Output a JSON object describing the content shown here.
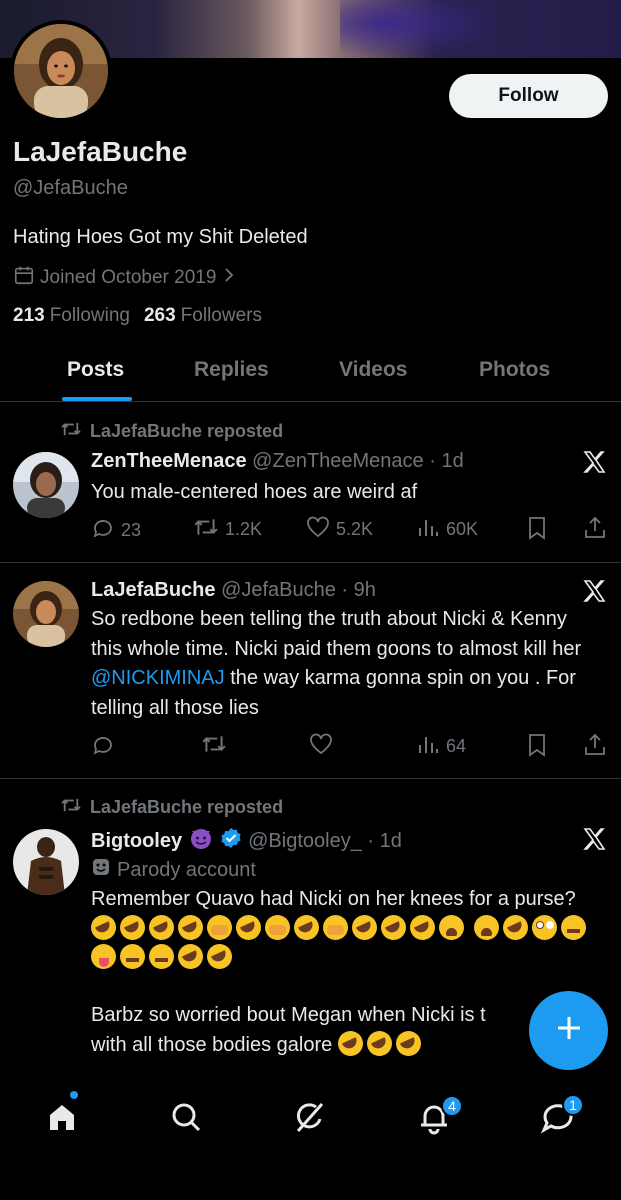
{
  "profile": {
    "display_name": "LaJefaBuche",
    "handle": "@JefaBuche",
    "bio": "Hating Hoes Got my Shit Deleted",
    "joined": "Joined October 2019",
    "following_count": "213",
    "following_label": "Following",
    "followers_count": "263",
    "followers_label": "Followers",
    "follow_label": "Follow"
  },
  "tabs": [
    {
      "label": "Posts",
      "active": true
    },
    {
      "label": "Replies",
      "active": false
    },
    {
      "label": "Videos",
      "active": false
    },
    {
      "label": "Photos",
      "active": false
    }
  ],
  "posts": [
    {
      "repost_label": "LaJefaBuche reposted",
      "name": "ZenTheeMenace",
      "handle_time": "@ZenTheeMenace · 1d",
      "text": "You male-centered hoes are weird af",
      "replies": "23",
      "reposts": "1.2K",
      "likes": "5.2K",
      "views": "60K"
    },
    {
      "name": "LaJefaBuche",
      "handle_time": "@JefaBuche · 9h",
      "text_before": "So redbone been telling the truth about Nicki & Kenny this whole time. Nicki paid them goons to almost kill her ",
      "mention": "@NICKIMINAJ",
      "text_after": " the way karma gonna spin on you . For telling all those lies",
      "views": "64"
    },
    {
      "repost_label": "LaJefaBuche reposted",
      "name": "Bigtooley",
      "handle_time": "@Bigtooley_ · 1d",
      "parody_label": "Parody account",
      "text_line1": "Remember Quavo had Nicki on her knees for a purse?",
      "text_line2": "Barbz so worried bout Megan when Nicki is t",
      "text_line3": "with all those bodies galore"
    }
  ],
  "nav": {
    "notifications_badge": "4",
    "messages_badge": "1"
  },
  "colors": {
    "accent": "#1d9bf0",
    "muted": "#71767b",
    "text": "#e7e9ea",
    "background": "#000000"
  }
}
